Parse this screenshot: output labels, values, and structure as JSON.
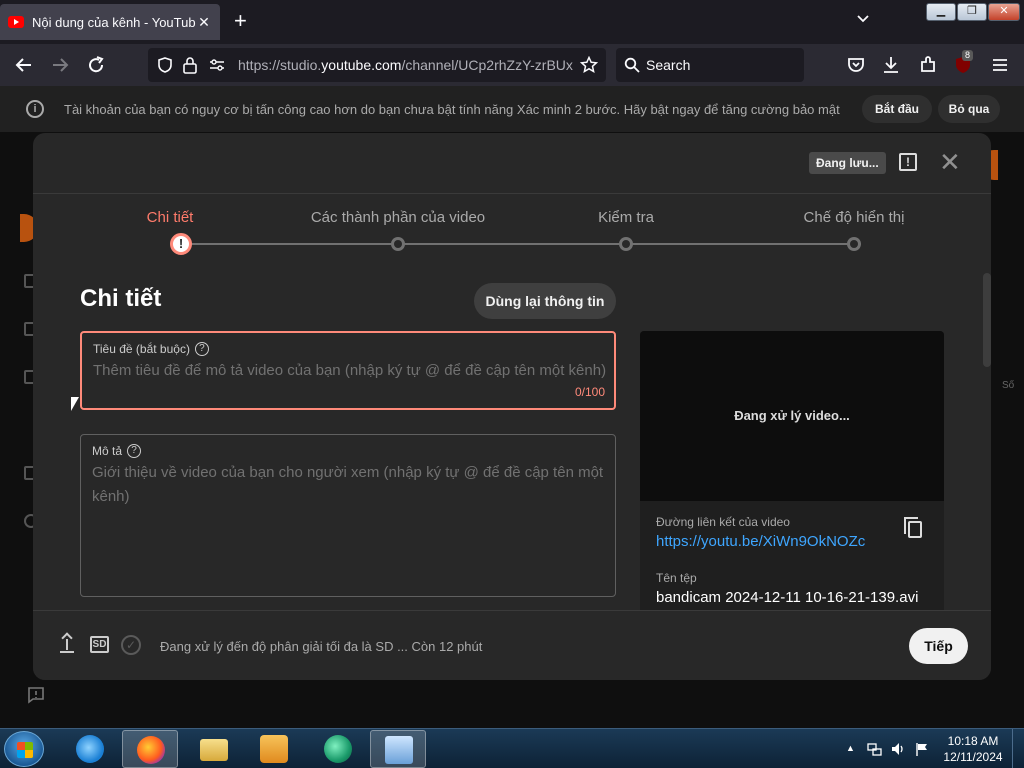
{
  "browser": {
    "tab_title": "Nội dung của kênh - YouTube Studio",
    "tab_close": "✕",
    "new_tab": "+",
    "url_prefix": "https://studio.",
    "url_host": "youtube.com",
    "url_rest": "/channel/UCp2rhZzY-zrBUx",
    "search_placeholder": "Search",
    "extension_badge": "8"
  },
  "banner": {
    "info_icon": "i",
    "text": "Tài khoản của bạn có nguy cơ bị tấn công cao hơn do bạn chưa bật tính năng Xác minh 2 bước. Hãy bật ngay để tăng cường bảo mật",
    "start_label": "Bắt đầu",
    "skip_label": "Bỏ qua"
  },
  "dialog": {
    "saving_label": "Đang lưu...",
    "feedback_icon": "!",
    "close_icon": "✕",
    "steps": [
      {
        "label": "Chi tiết",
        "state": "error"
      },
      {
        "label": "Các thành phần của video",
        "state": "todo"
      },
      {
        "label": "Kiểm tra",
        "state": "todo"
      },
      {
        "label": "Chế độ hiển thị",
        "state": "todo"
      }
    ],
    "step_error_glyph": "!",
    "section_title": "Chi tiết",
    "reuse_button": "Dùng lại thông tin",
    "title_field": {
      "label": "Tiêu đề (bắt buộc)",
      "placeholder": "Thêm tiêu đề để mô tả video của bạn (nhập ký tự @ để đề cập tên một kênh)",
      "counter": "0/100"
    },
    "description_field": {
      "label": "Mô tả",
      "placeholder": "Giới thiệu về video của bạn cho người xem (nhập ký tự @ để đề cập tên một kênh)"
    },
    "help_glyph": "?",
    "preview": {
      "processing": "Đang xử lý video...",
      "link_label": "Đường liên kết của video",
      "link_value": "https://youtu.be/XiWn9OkNOZc",
      "file_label": "Tên tệp",
      "file_value": "bandicam 2024-12-11 10-16-21-139.avi"
    },
    "footer": {
      "sd_label": "SD",
      "check_glyph": "✓",
      "status": "Đang xử lý đến độ phân giải tối đa là SD ... Còn 12 phút",
      "next_button": "Tiếp"
    }
  },
  "taskbar": {
    "time": "10:18 AM",
    "date": "12/11/2024",
    "tray_arrow": "▲",
    "apps": [
      "internet-explorer",
      "firefox",
      "file-explorer",
      "media-player",
      "app-icon",
      "control-panel"
    ]
  },
  "colors": {
    "accent_error": "#ff8a7a",
    "link_blue": "#3ea6ff",
    "dialog_bg": "#282828"
  }
}
